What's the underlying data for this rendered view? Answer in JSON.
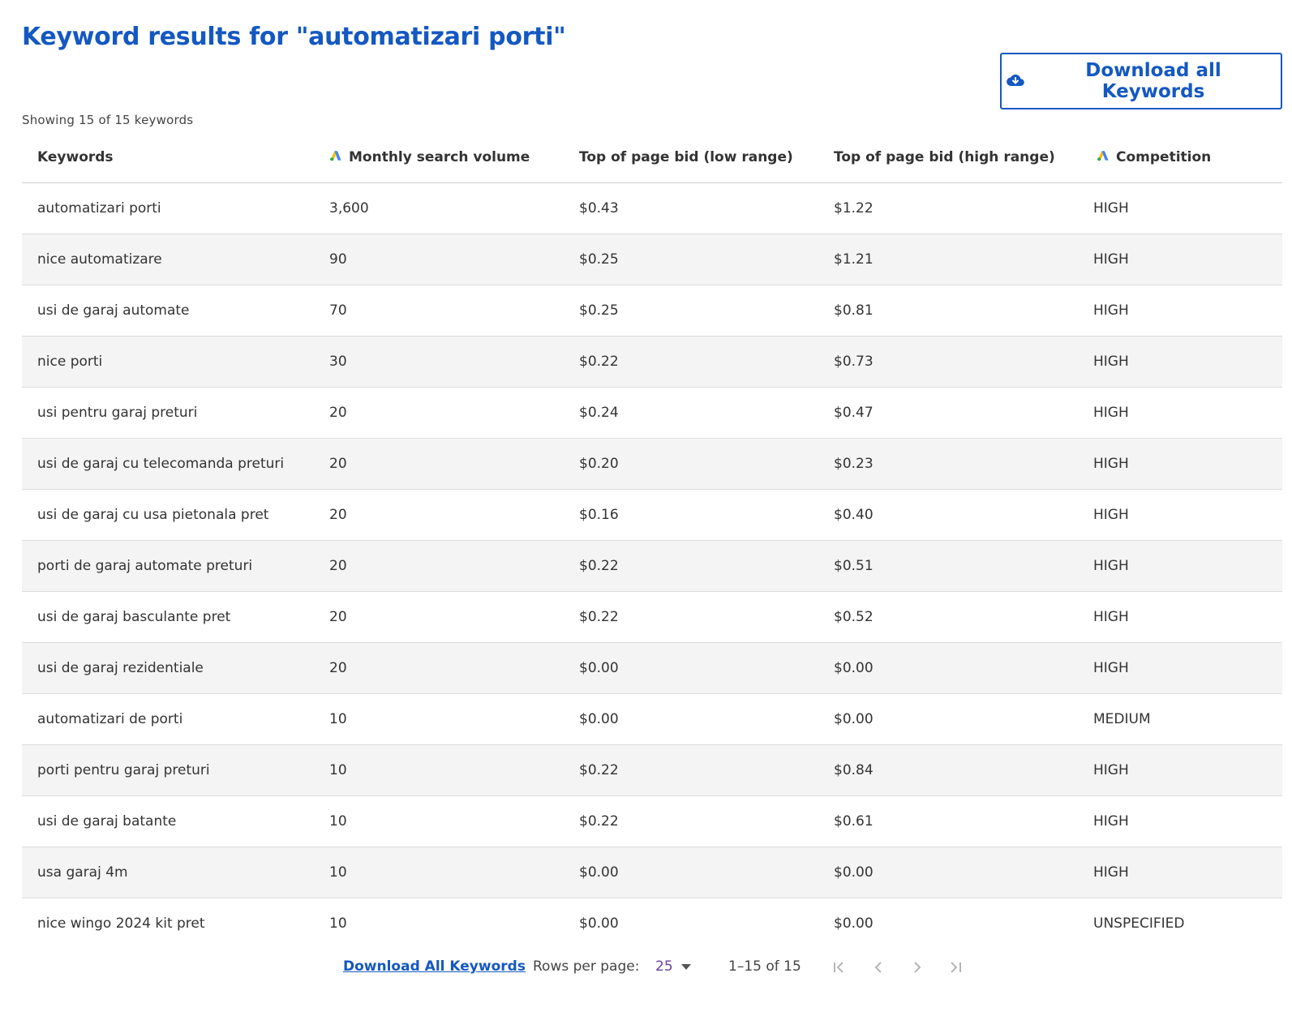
{
  "title": "Keyword results for \"automatizari porti\"",
  "download_button": "Download all Keywords",
  "showing_text": "Showing 15 of 15 keywords",
  "columns": [
    "Keywords",
    "Monthly search volume",
    "Top of page bid (low range)",
    "Top of page bid (high range)",
    "Competition"
  ],
  "rows": [
    [
      "automatizari porti",
      "3,600",
      "$0.43",
      "$1.22",
      "HIGH"
    ],
    [
      "nice automatizare",
      "90",
      "$0.25",
      "$1.21",
      "HIGH"
    ],
    [
      "usi de garaj automate",
      "70",
      "$0.25",
      "$0.81",
      "HIGH"
    ],
    [
      "nice porti",
      "30",
      "$0.22",
      "$0.73",
      "HIGH"
    ],
    [
      "usi pentru garaj preturi",
      "20",
      "$0.24",
      "$0.47",
      "HIGH"
    ],
    [
      "usi de garaj cu telecomanda preturi",
      "20",
      "$0.20",
      "$0.23",
      "HIGH"
    ],
    [
      "usi de garaj cu usa pietonala pret",
      "20",
      "$0.16",
      "$0.40",
      "HIGH"
    ],
    [
      "porti de garaj automate preturi",
      "20",
      "$0.22",
      "$0.51",
      "HIGH"
    ],
    [
      "usi de garaj basculante pret",
      "20",
      "$0.22",
      "$0.52",
      "HIGH"
    ],
    [
      "usi de garaj rezidentiale",
      "20",
      "$0.00",
      "$0.00",
      "HIGH"
    ],
    [
      "automatizari de porti",
      "10",
      "$0.00",
      "$0.00",
      "MEDIUM"
    ],
    [
      "porti pentru garaj preturi",
      "10",
      "$0.22",
      "$0.84",
      "HIGH"
    ],
    [
      "usi de garaj batante",
      "10",
      "$0.22",
      "$0.61",
      "HIGH"
    ],
    [
      "usa garaj 4m",
      "10",
      "$0.00",
      "$0.00",
      "HIGH"
    ],
    [
      "nice wingo 2024 kit pret",
      "10",
      "$0.00",
      "$0.00",
      "UNSPECIFIED"
    ]
  ],
  "footer": {
    "download_link": "Download All Keywords",
    "rows_per_page_label": "Rows per page:",
    "rows_per_page_value": "25",
    "range_text": "1–15 of 15"
  },
  "icons": {
    "download": "cloud-download-icon",
    "ads": "google-ads-icon",
    "first_page": "first-page-icon",
    "prev_page": "chevron-left-icon",
    "next_page": "chevron-right-icon",
    "last_page": "last-page-icon"
  },
  "colors": {
    "accent": "#1458c2",
    "rows_select": "#6a3fa0",
    "alt_row": "#f4f4f4"
  }
}
